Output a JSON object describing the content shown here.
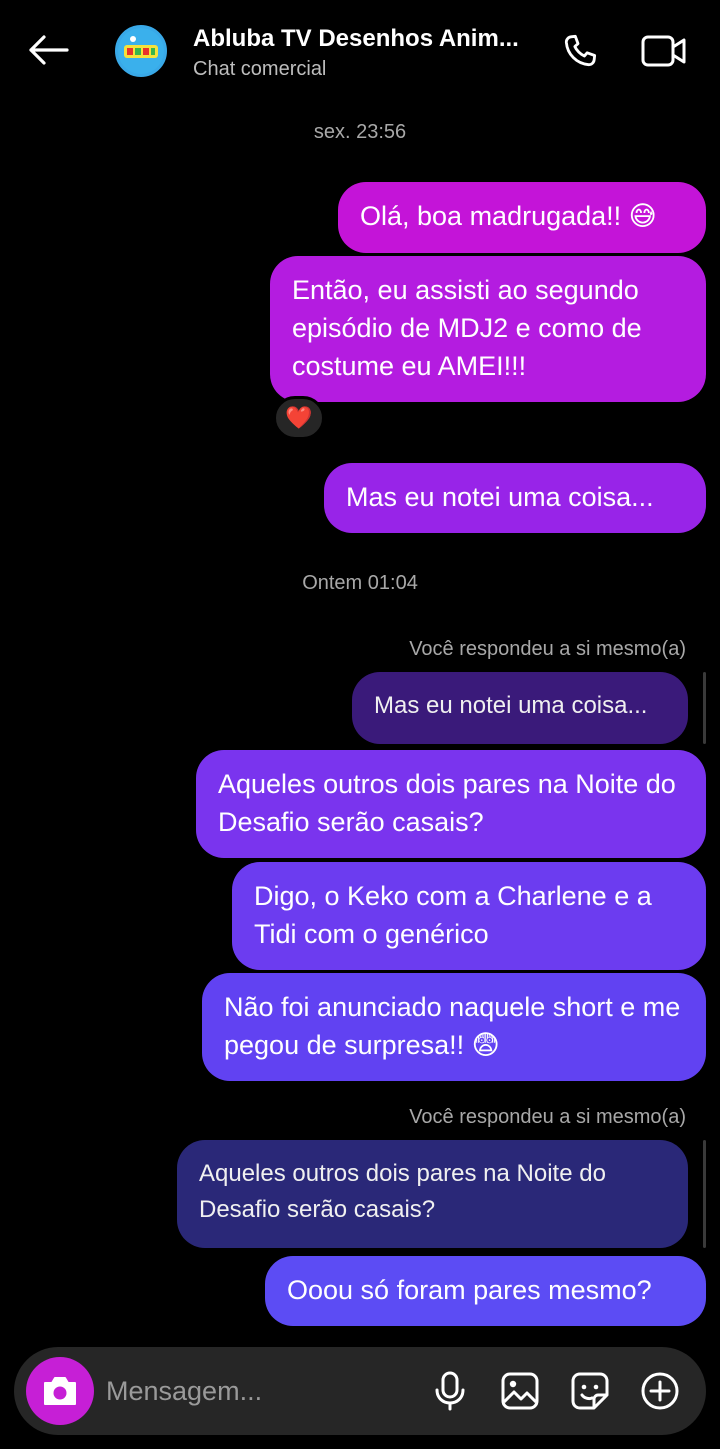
{
  "header": {
    "title": "Abluba TV Desenhos Anim...",
    "subtitle": "Chat comercial",
    "avatar_text": "ABLUBA"
  },
  "timestamps": [
    "sex. 23:56",
    "Ontem 01:04"
  ],
  "messages": [
    {
      "text": "Olá, boa madrugada!! 😅"
    },
    {
      "text": "Então, eu assisti ao segundo episódio de MDJ2 e como de costume eu AMEI!!!",
      "reaction": "❤️"
    },
    {
      "text": "Mas eu notei uma coisa..."
    },
    {
      "text": "Aqueles outros dois pares na Noite do Desafio serão casais?"
    },
    {
      "text": "Digo, o Keko com a Charlene e a Tidi com o genérico"
    },
    {
      "text": "Não foi anunciado naquele short e me pegou de surpresa!! 😨"
    },
    {
      "text": "Ooou só foram pares mesmo?"
    }
  ],
  "replies": [
    {
      "label": "Você respondeu a si mesmo(a)",
      "quoted": "Mas eu notei uma coisa..."
    },
    {
      "label": "Você respondeu a si mesmo(a)",
      "quoted": "Aqueles outros dois pares na Noite do Desafio serão casais?"
    }
  ],
  "composer": {
    "placeholder": "Mensagem..."
  },
  "colors": {
    "background": "#000000",
    "bubble_top": "#c414d8",
    "bubble_bottom": "#5c4cf4",
    "composer": "#262626",
    "camera": "#c61fd6"
  }
}
